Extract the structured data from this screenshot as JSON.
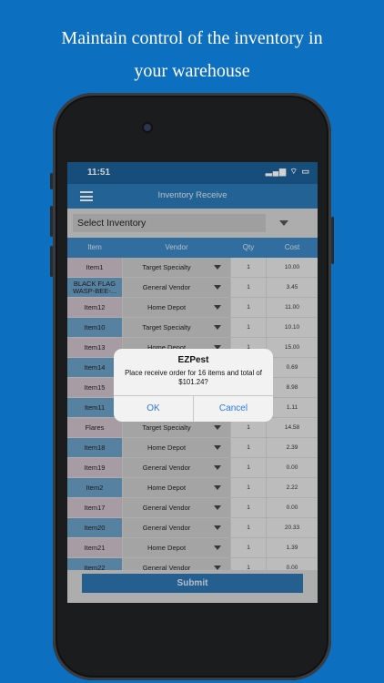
{
  "promo": {
    "line1": "Maintain control of the inventory in",
    "line2": "your warehouse"
  },
  "status": {
    "time": "11:51",
    "icons": "▂▄▆ ⌔ ▭"
  },
  "nav": {
    "title": "Inventory Receive"
  },
  "select": {
    "label": "Select Inventory"
  },
  "table": {
    "headers": {
      "item": "Item",
      "vendor": "Vendor",
      "qty": "Qty",
      "cost": "Cost"
    },
    "rows": [
      {
        "item": "Item1",
        "vendor": "Target Specialty",
        "qty": "1",
        "cost": "10.00"
      },
      {
        "item": "BLACK FLAG WASP-BEE-...",
        "vendor": "General Vendor",
        "qty": "1",
        "cost": "3.45"
      },
      {
        "item": "Item12",
        "vendor": "Home Depot",
        "qty": "1",
        "cost": "11.00"
      },
      {
        "item": "Item10",
        "vendor": "Target Specialty",
        "qty": "1",
        "cost": "10.10"
      },
      {
        "item": "Item13",
        "vendor": "Home Depot",
        "qty": "1",
        "cost": "15.00"
      },
      {
        "item": "Item14",
        "vendor": "",
        "qty": "",
        "cost": "0.69"
      },
      {
        "item": "Item15",
        "vendor": "",
        "qty": "",
        "cost": "8.98"
      },
      {
        "item": "Item11",
        "vendor": "",
        "qty": "",
        "cost": "1.11"
      },
      {
        "item": "Flares",
        "vendor": "Target Specialty",
        "qty": "1",
        "cost": "14.58"
      },
      {
        "item": "Item18",
        "vendor": "Home Depot",
        "qty": "1",
        "cost": "2.39"
      },
      {
        "item": "Item19",
        "vendor": "General Vendor",
        "qty": "1",
        "cost": "0.00"
      },
      {
        "item": "Item2",
        "vendor": "Home Depot",
        "qty": "1",
        "cost": "2.22"
      },
      {
        "item": "Item17",
        "vendor": "General Vendor",
        "qty": "1",
        "cost": "0.00"
      },
      {
        "item": "Item20",
        "vendor": "General Vendor",
        "qty": "1",
        "cost": "20.33"
      },
      {
        "item": "Item21",
        "vendor": "Home Depot",
        "qty": "1",
        "cost": "1.39"
      },
      {
        "item": "Item22",
        "vendor": "General Vendor",
        "qty": "1",
        "cost": "0.00"
      }
    ]
  },
  "submit": {
    "label": "Submit"
  },
  "alert": {
    "title": "EZPest",
    "message": "Place receive order for 16 items and total of $101.24?",
    "ok": "OK",
    "cancel": "Cancel"
  },
  "colors": {
    "background": "#0d6fc0",
    "navbar": "#2b78b5",
    "header": "#3d86c4",
    "itemPink": "#cdbfc8",
    "itemBlue": "#6b9ec4",
    "alertButton": "#2a7ae2"
  }
}
